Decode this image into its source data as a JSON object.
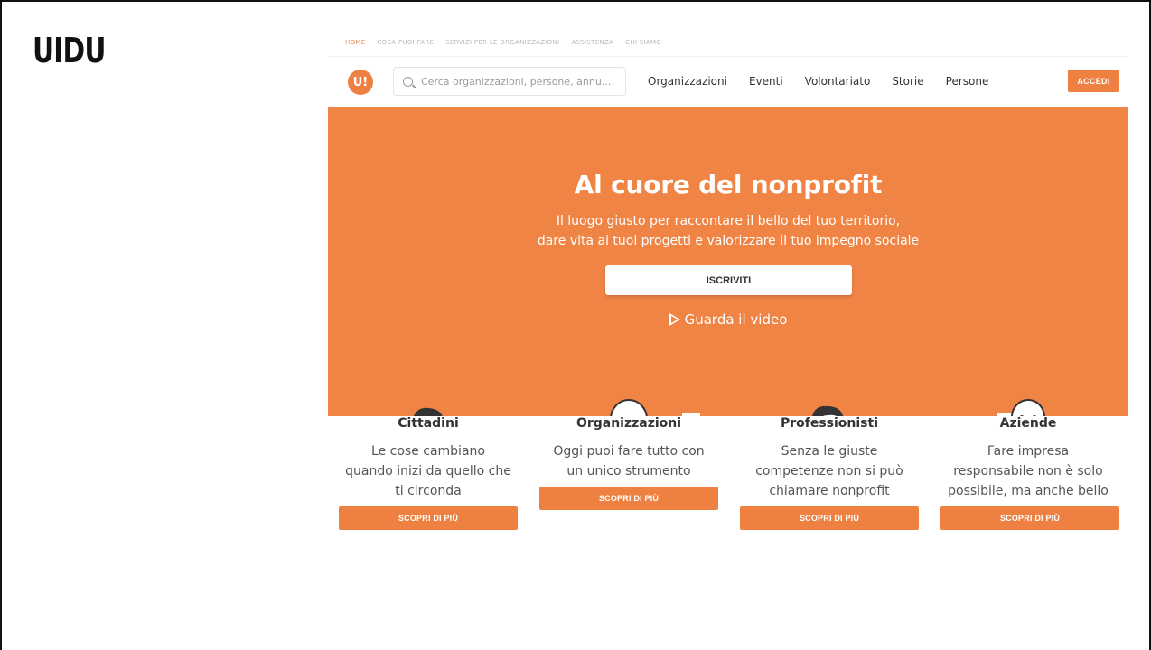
{
  "slide": {
    "title": "UIDU"
  },
  "topbar": {
    "links": [
      "HOME",
      "COSA PUOI FARE",
      "SERVIZI PER LE ORGANIZZAZIONI",
      "ASSISTENZA",
      "CHI SIAMO"
    ]
  },
  "navbar": {
    "logo_text": "U!",
    "search_placeholder": "Cerca organizzazioni, persone, annu...",
    "links": [
      "Organizzazioni",
      "Eventi",
      "Volontariato",
      "Storie",
      "Persone"
    ],
    "login_label": "ACCEDI"
  },
  "hero": {
    "title": "Al cuore del nonprofit",
    "subtitle_line1": "Il luogo giusto per raccontare il bello del tuo territorio,",
    "subtitle_line2": "dare vita ai tuoi progetti e valorizzare il tuo impegno sociale",
    "signup_label": "ISCRIVITI",
    "video_label": "Guarda il video"
  },
  "audiences": [
    {
      "title": "Cittadini",
      "lines": [
        "Le cose cambiano",
        "quando inizi da quello che",
        "ti circonda"
      ],
      "cta": "SCOPRI DI PIÙ"
    },
    {
      "title": "Organizzazioni",
      "lines": [
        "Oggi puoi fare tutto con",
        "un unico strumento"
      ],
      "cta": "SCOPRI DI PIÙ"
    },
    {
      "title": "Professionisti",
      "lines": [
        "Senza le giuste",
        "competenze non si può",
        "chiamare nonprofit"
      ],
      "cta": "SCOPRI DI PIÙ"
    },
    {
      "title": "Aziende",
      "lines": [
        "Fare impresa",
        "responsabile non è solo",
        "possibile, ma anche bello"
      ],
      "cta": "SCOPRI DI PIÙ"
    }
  ],
  "colors": {
    "brand_orange": "#ef8444",
    "text_dark": "#333333"
  }
}
